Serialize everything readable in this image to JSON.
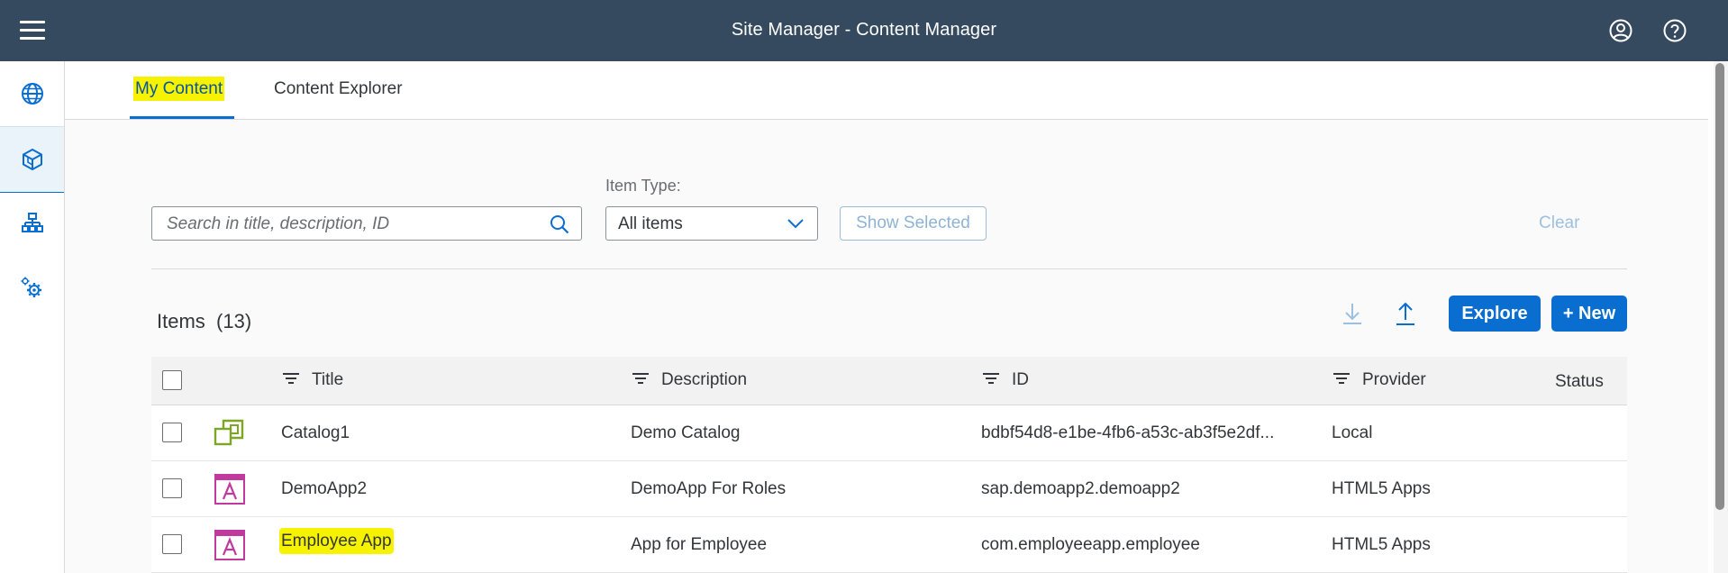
{
  "shell": {
    "title": "Site Manager - Content Manager",
    "menu_icon": "hamburger-icon",
    "user_icon": "user-icon",
    "help_icon": "help-icon"
  },
  "sidenav": {
    "items": [
      {
        "icon": "globe-icon"
      },
      {
        "icon": "cube-icon",
        "active": true
      },
      {
        "icon": "hierarchy-icon"
      },
      {
        "icon": "settings-gears-icon"
      }
    ]
  },
  "tabs": [
    {
      "label": "My Content",
      "active": true
    },
    {
      "label": "Content Explorer",
      "active": false
    }
  ],
  "filters": {
    "search_placeholder": "Search in title, description, ID",
    "item_type_label": "Item Type:",
    "item_type_value": "All items",
    "show_selected": "Show Selected",
    "clear": "Clear"
  },
  "toolbar": {
    "items_title": "Items",
    "items_count": "(13)",
    "download_icon": "download-icon",
    "upload_icon": "upload-icon",
    "explore": "Explore",
    "new": "+ New"
  },
  "table": {
    "columns": [
      "Title",
      "Description",
      "ID",
      "Provider",
      "Status"
    ],
    "rows": [
      {
        "type_icon": "catalog-icon",
        "title": "Catalog1",
        "description": "Demo Catalog",
        "id": "bdbf54d8-e1be-4fb6-a53c-ab3f5e2df...",
        "provider": "Local",
        "status": ""
      },
      {
        "type_icon": "app-icon",
        "title": "DemoApp2",
        "description": "DemoApp For Roles",
        "id": "sap.demoapp2.demoapp2",
        "provider": "HTML5 Apps",
        "status": ""
      },
      {
        "type_icon": "app-icon",
        "title": "Employee App",
        "description": "App for Employee",
        "id": "com.employeeapp.employee",
        "provider": "HTML5 Apps",
        "status": ""
      }
    ]
  },
  "colors": {
    "shell": "#354a5f",
    "accent": "#0a6ed1",
    "highlight": "#f7f300",
    "catalog_icon": "#7ea626",
    "app_icon": "#c0399f"
  }
}
